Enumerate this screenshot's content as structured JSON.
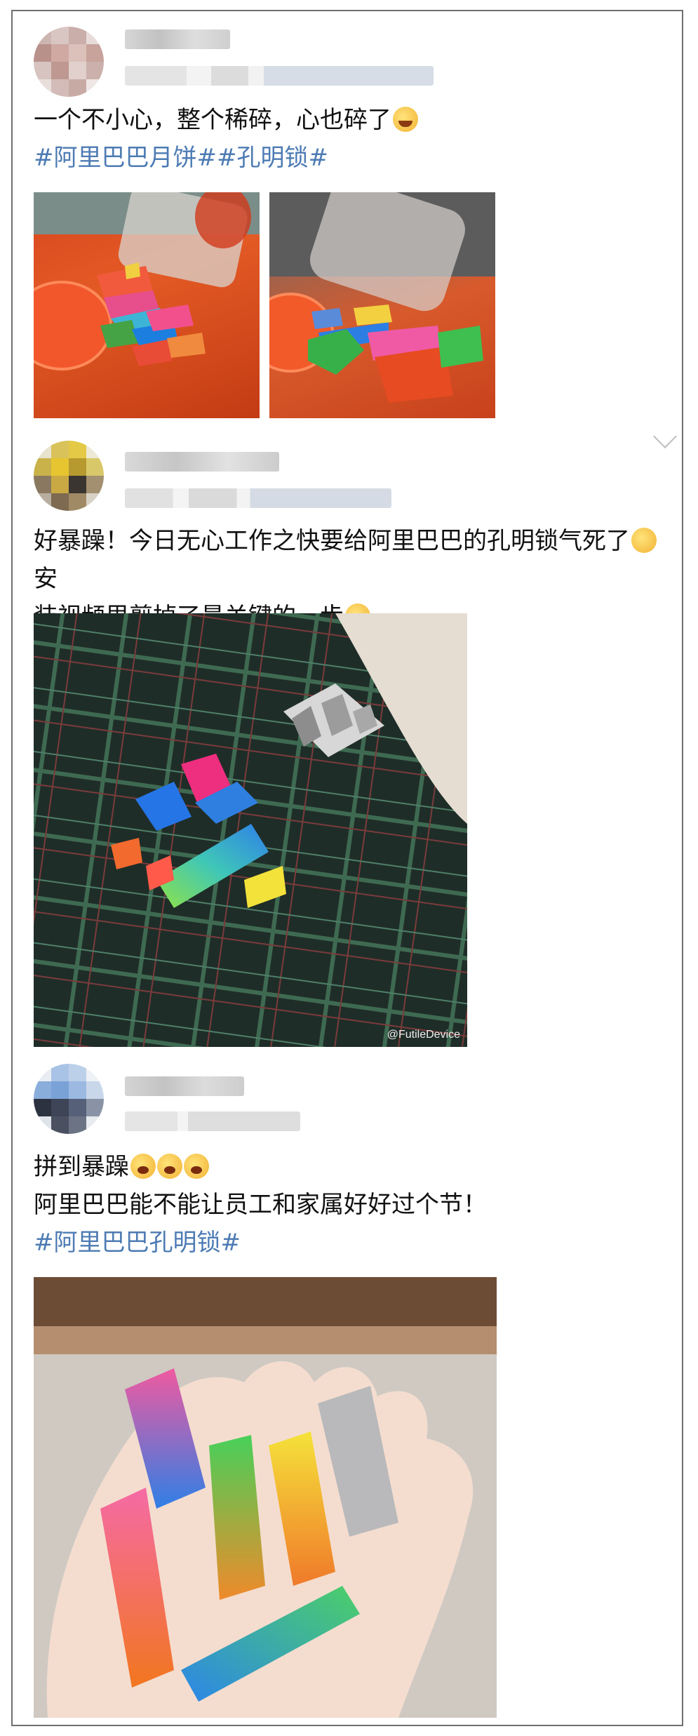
{
  "posts": [
    {
      "text_line1": "一个不小心，整个稀碎，心也碎了",
      "hashtags": "#阿里巴巴月饼##孔明锁#",
      "emoji": "laugh-cry-emoji"
    },
    {
      "text_line1": "好暴躁！今日无心工作之快要给阿里巴巴的孔明锁气死了",
      "text_line1_tail": "安",
      "text_line2": "装视频里剪掉了最关键的一步",
      "watermark": "@FutileDevice",
      "emoji": "grimace-emoji"
    },
    {
      "text_line1": "拼到暴躁",
      "text_line2": "阿里巴巴能不能让员工和家属好好过个节！",
      "hashtags": "#阿里巴巴孔明锁#",
      "emoji": "angry-emoji"
    }
  ],
  "colors": {
    "hashtag": "#4d7bb3",
    "text": "#111111",
    "frame_border": "#6f6f6f"
  }
}
